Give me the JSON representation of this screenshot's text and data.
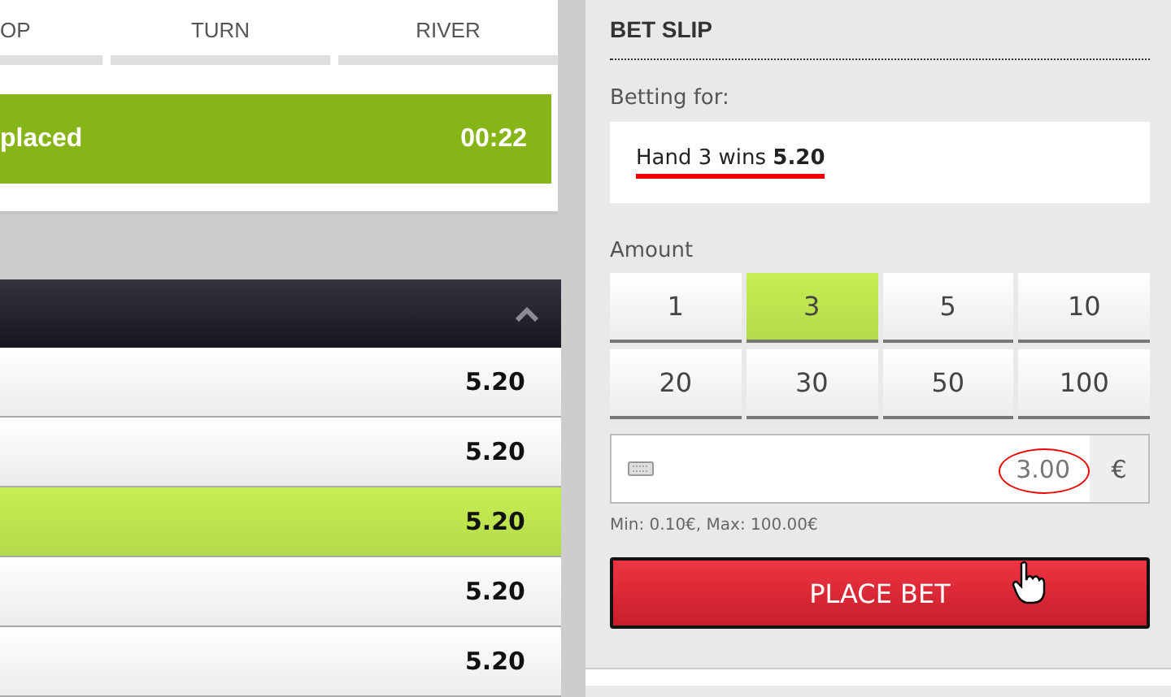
{
  "stages": [
    {
      "label": "OP"
    },
    {
      "label": "TURN"
    },
    {
      "label": "RIVER"
    }
  ],
  "banner": {
    "text": "placed",
    "timer": "00:22"
  },
  "odds_table": {
    "rows": [
      {
        "odds": "5.20",
        "selected": false
      },
      {
        "odds": "5.20",
        "selected": false
      },
      {
        "odds": "5.20",
        "selected": true
      },
      {
        "odds": "5.20",
        "selected": false
      },
      {
        "odds": "5.20",
        "selected": false
      }
    ]
  },
  "bet_slip": {
    "title": "BET SLIP",
    "betting_for_label": "Betting for:",
    "selection": "Hand 3 wins **5.20**",
    "amount_label": "Amount",
    "amounts": [
      {
        "label": "1",
        "selected": false
      },
      {
        "label": "3",
        "selected": true
      },
      {
        "label": "5",
        "selected": false
      },
      {
        "label": "10",
        "selected": false
      },
      {
        "label": "20",
        "selected": false
      },
      {
        "label": "30",
        "selected": false
      },
      {
        "label": "50",
        "selected": false
      },
      {
        "label": "100",
        "selected": false
      }
    ],
    "stake_value": "3.00",
    "currency": "€",
    "limits": "Min: 0.10€, Max: 100.00€",
    "place_bet": "PLACE BET"
  }
}
